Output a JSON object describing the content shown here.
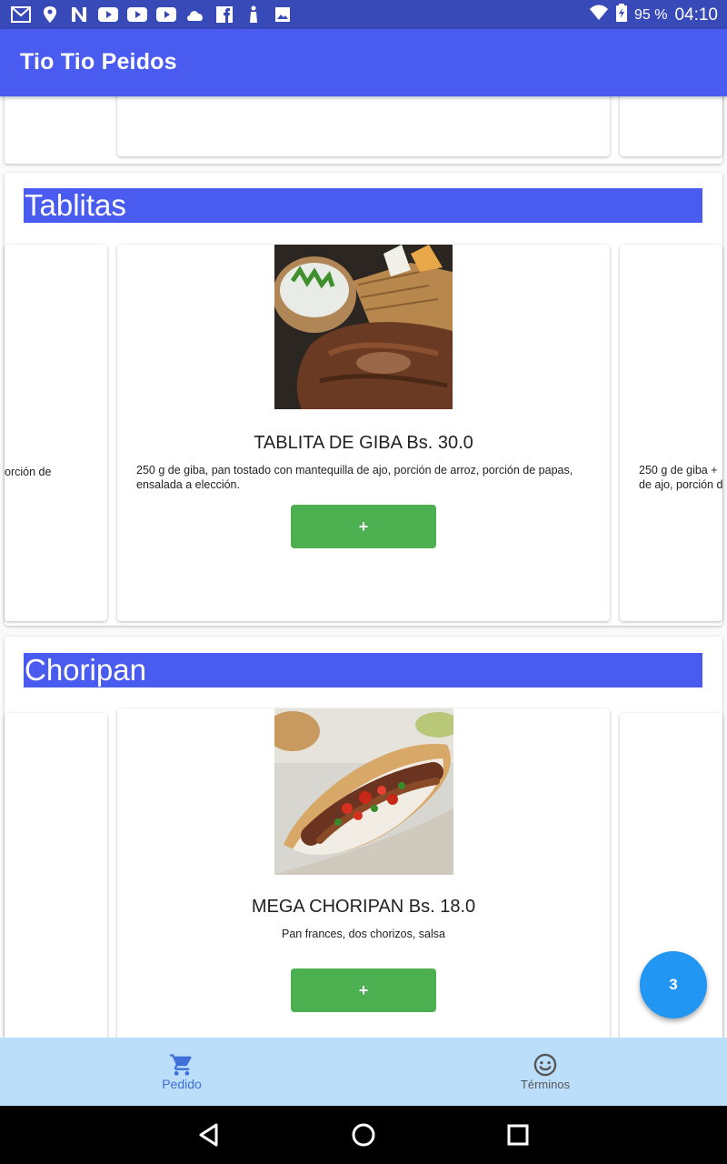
{
  "status_bar": {
    "battery": "95 %",
    "time": "04:10",
    "notification_icons": [
      "gmail-icon",
      "maps-icon",
      "news-icon",
      "youtube-icon",
      "youtube-icon",
      "youtube-icon",
      "cloud-icon",
      "facebook-icon",
      "figure-icon",
      "image-icon"
    ]
  },
  "app_bar": {
    "title": "Tio Tio Peidos"
  },
  "sections": [
    {
      "header": "Tablitas",
      "card": {
        "title": "TABLITA DE GIBA Bs. 30.0",
        "description": "250 g de giba, pan tostado con mantequilla de ajo, porción de arroz, porción de papas, ensalada a elección.",
        "add_label": "+"
      },
      "left_peek_text": "orción de",
      "right_peek_text_line1": "250 g de giba +",
      "right_peek_text_line2": "de ajo, porción d"
    },
    {
      "header": "Choripan",
      "card": {
        "title": "MEGA CHORIPAN Bs. 18.0",
        "description": "Pan frances, dos chorizos, salsa",
        "add_label": "+"
      }
    }
  ],
  "fab": {
    "count": "3"
  },
  "bottom_nav": {
    "items": [
      {
        "label": "Pedido",
        "icon": "cart-icon",
        "active": true
      },
      {
        "label": "Términos",
        "icon": "smiley-icon",
        "active": false
      }
    ]
  },
  "colors": {
    "status_bar": "#3849b8",
    "app_bar": "#4a5cf0",
    "section_header": "#4a5cf0",
    "add_button": "#4caf50",
    "fab": "#2196f3",
    "bottom_nav": "#bbdefb"
  }
}
